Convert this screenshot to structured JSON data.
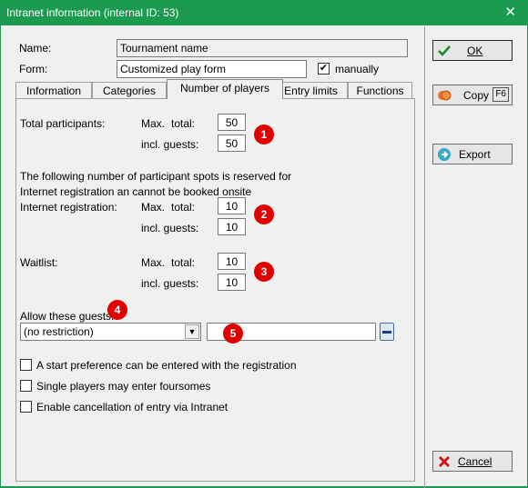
{
  "window": {
    "title": "Intranet information (internal ID: 53)"
  },
  "header": {
    "name_label": "Name:",
    "name_value": "Tournament name",
    "form_label": "Form:",
    "form_value": "Customized play form",
    "manually_label": "manually",
    "manually_checked": true
  },
  "tabs": [
    {
      "label": "Information",
      "active": false
    },
    {
      "label": "Categories",
      "active": false
    },
    {
      "label": "Number of players",
      "active": true
    },
    {
      "label": "Entry limits",
      "active": false
    },
    {
      "label": "Functions",
      "active": false
    }
  ],
  "players": {
    "total_participants_label": "Total participants:",
    "max_label": "Max.",
    "total_label": "total:",
    "incl_guests_label": "incl. guests:",
    "total_participants_total": "50",
    "total_participants_guests": "50",
    "reserved_note_line1": "The following number of participant spots is reserved for",
    "reserved_note_line2": "Internet registration an cannot be booked onsite",
    "internet_registration_label": "Internet registration:",
    "internet_total": "10",
    "internet_guests": "10",
    "waitlist_label": "Waitlist:",
    "waitlist_total": "10",
    "waitlist_guests": "10",
    "allow_guests_label": "Allow these guests:",
    "allow_guests_value": "(no restriction)",
    "guest_club_value": ""
  },
  "badges": [
    "1",
    "2",
    "3",
    "4",
    "5"
  ],
  "options": [
    {
      "label": "A start preference can be entered with the registration",
      "checked": false
    },
    {
      "label": "Single players may enter foursomes",
      "checked": false
    },
    {
      "label": "Enable cancellation of entry via Intranet",
      "checked": false
    }
  ],
  "buttons": {
    "ok": "OK",
    "copy": "Copy",
    "copy_key": "F6",
    "export": "Export",
    "cancel": "Cancel"
  },
  "colors": {
    "titlebar": "#1c9a50",
    "badge": "#e00000"
  }
}
